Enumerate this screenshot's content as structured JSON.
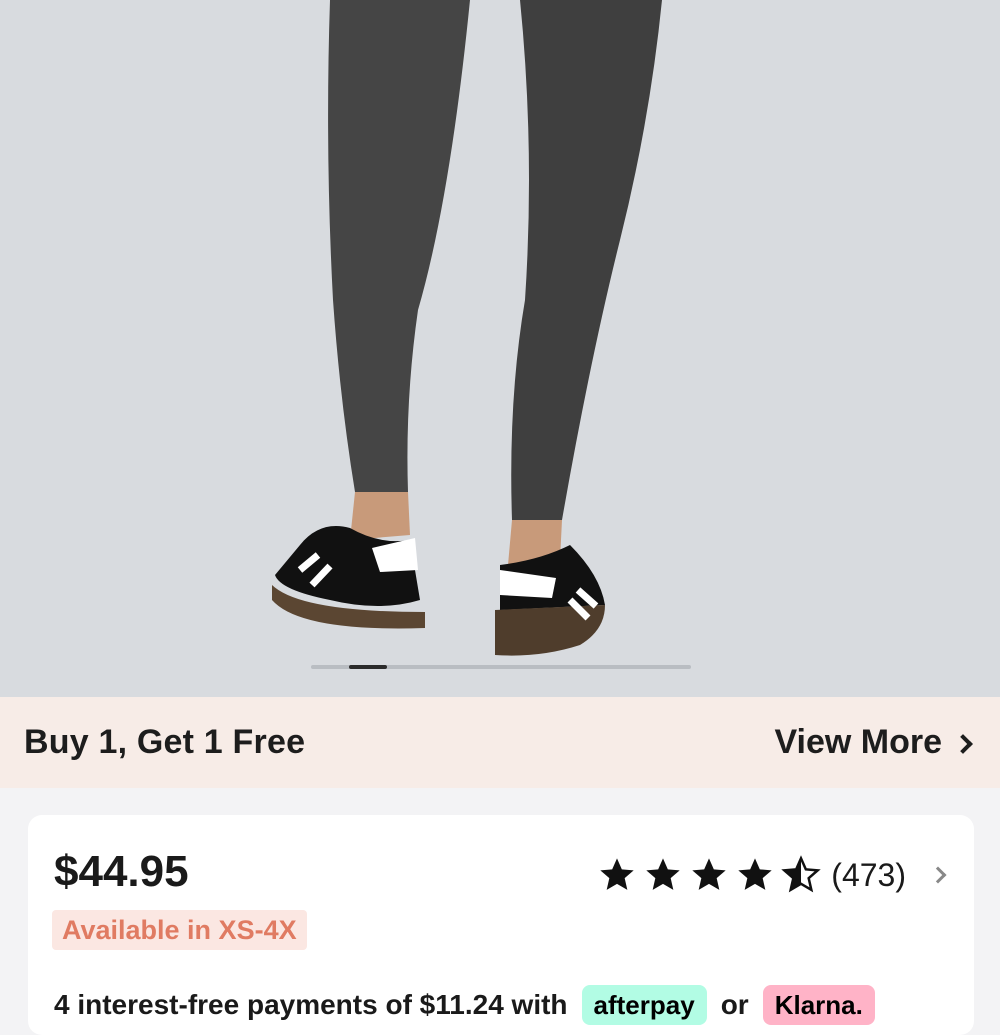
{
  "hero": {
    "image_alt": "",
    "carousel": {
      "current_index": 2,
      "total": 10
    }
  },
  "promo": {
    "text": "Buy 1, Get 1  Free",
    "view_more_label": "View More"
  },
  "product": {
    "price": "$44.95",
    "availability": "Available in XS-4X",
    "rating": {
      "stars": 4.5,
      "count_label": "(473)"
    },
    "payment_text": "4 interest-free payments of $11.24 with",
    "afterpay_label": "afterpay",
    "or_label": "or",
    "klarna_label": "Klarna."
  },
  "colors": {
    "promo_bg": "#f7ece7",
    "availability_text": "#e07b62",
    "availability_bg": "#fbe7e2",
    "afterpay_badge": "#b2fce4",
    "klarna_badge": "#ffb3c7"
  }
}
